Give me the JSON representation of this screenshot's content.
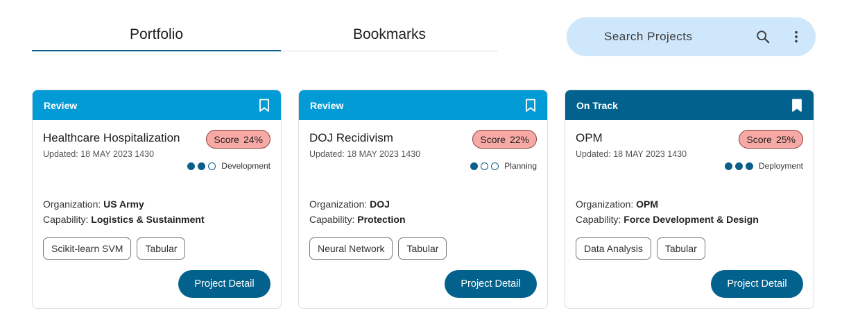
{
  "tabs": [
    {
      "label": "Portfolio",
      "active": true
    },
    {
      "label": "Bookmarks",
      "active": false
    }
  ],
  "search": {
    "placeholder": "Search Projects",
    "icon": "search-icon",
    "menu_icon": "kebab-icon"
  },
  "colors": {
    "accent": "#03628d",
    "review": "#039bd6",
    "score_badge": "#f7aaa5",
    "search_bg": "#cfe7fb"
  },
  "cards": [
    {
      "status": "Review",
      "bookmarked": false,
      "title": "Healthcare Hospitalization",
      "updated": "Updated: 18 MAY 2023 1430",
      "score_label": "Score",
      "score": "24%",
      "stage_progress": [
        true,
        true,
        false
      ],
      "stage": "Development",
      "org_label": "Organization: ",
      "organization": "US Army",
      "cap_label": "Capability: ",
      "capability": "Logistics & Sustainment",
      "tags": [
        "Scikit-learn SVM",
        "Tabular"
      ],
      "button": "Project Detail"
    },
    {
      "status": "Review",
      "bookmarked": false,
      "title": "DOJ Recidivism",
      "updated": "Updated: 18 MAY 2023 1430",
      "score_label": "Score",
      "score": "22%",
      "stage_progress": [
        true,
        false,
        false
      ],
      "stage": "Planning",
      "org_label": "Organization: ",
      "organization": "DOJ",
      "cap_label": "Capability: ",
      "capability": "Protection",
      "tags": [
        "Neural Network",
        "Tabular"
      ],
      "button": "Project Detail"
    },
    {
      "status": "On Track",
      "bookmarked": true,
      "title": "OPM",
      "updated": "Updated: 18 MAY 2023 1430",
      "score_label": "Score",
      "score": "25%",
      "stage_progress": [
        true,
        true,
        true
      ],
      "stage": "Deployment",
      "org_label": "Organization: ",
      "organization": "OPM",
      "cap_label": "Capability: ",
      "capability": "Force Development & Design",
      "tags": [
        "Data Analysis",
        "Tabular"
      ],
      "button": "Project Detail"
    }
  ]
}
